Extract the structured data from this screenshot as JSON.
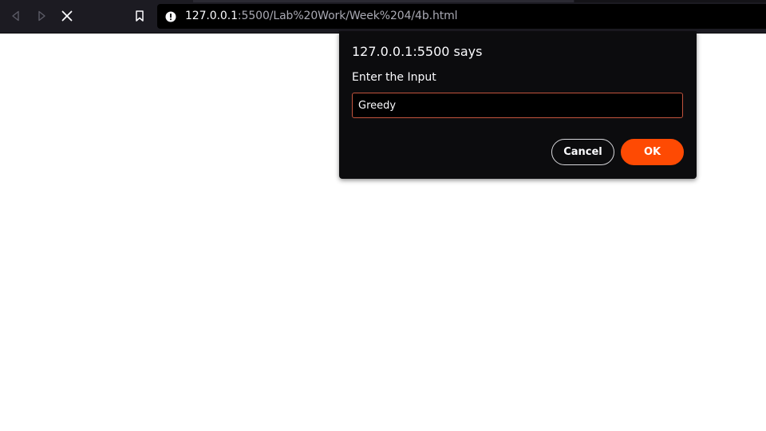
{
  "browser": {
    "url_host": "127.0.0.1",
    "url_path": ":5500/Lab%20Work/Week%204/4b.html",
    "icons": {
      "back": "back-arrow-icon",
      "forward": "forward-arrow-icon",
      "stop": "stop-loading-icon",
      "bookmark": "bookmark-icon",
      "site_info": "site-info-icon"
    }
  },
  "dialog": {
    "title": "127.0.0.1:5500 says",
    "message": "Enter the Input",
    "input_value": "Greedy",
    "cancel_label": "Cancel",
    "ok_label": "OK"
  },
  "colors": {
    "accent": "#fe4a03",
    "input_border": "#c2533d",
    "dialog_bg": "#0c0c0e",
    "toolbar_bg": "#1c1b22"
  }
}
